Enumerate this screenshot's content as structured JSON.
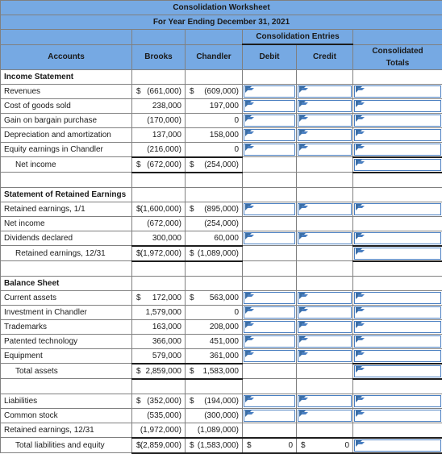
{
  "header": {
    "title": "Consolidation Worksheet",
    "subtitle": "For Year Ending December 31, 2021",
    "group_label": "Consolidation Entries",
    "columns": {
      "accounts": "Accounts",
      "brooks": "Brooks",
      "chandler": "Chandler",
      "debit": "Debit",
      "credit": "Credit",
      "consolidated": "Consolidated Totals",
      "consolidated_line1": "Consolidated",
      "consolidated_line2": "Totals"
    }
  },
  "colors": {
    "header_blue": "#76A9E3",
    "input_border": "#4a7fc1",
    "grid_line": "#808080",
    "rule_line": "#1d1d1d"
  },
  "sections": {
    "income_statement": {
      "label": "Income Statement",
      "rows": [
        {
          "label": "Revenues",
          "brooks_sym": "$",
          "brooks": "(661,000)",
          "chandler_sym": "$",
          "chandler": "(609,000)"
        },
        {
          "label": "Cost of goods sold",
          "brooks_sym": "",
          "brooks": "238,000",
          "chandler_sym": "",
          "chandler": "197,000"
        },
        {
          "label": "Gain on bargain purchase",
          "brooks_sym": "",
          "brooks": "(170,000)",
          "chandler_sym": "",
          "chandler": "0"
        },
        {
          "label": "Depreciation and amortization",
          "brooks_sym": "",
          "brooks": "137,000",
          "chandler_sym": "",
          "chandler": "158,000"
        },
        {
          "label": "Equity earnings in Chandler",
          "brooks_sym": "",
          "brooks": "(216,000)",
          "chandler_sym": "",
          "chandler": "0"
        }
      ],
      "total": {
        "label": "Net income",
        "brooks_sym": "$",
        "brooks": "(672,000)",
        "chandler_sym": "$",
        "chandler": "(254,000)"
      }
    },
    "retained_earnings": {
      "label": "Statement of Retained Earnings",
      "rows": [
        {
          "label": "Retained earnings, 1/1",
          "brooks_sym": "$",
          "brooks": "(1,600,000)",
          "chandler_sym": "$",
          "chandler": "(895,000)"
        },
        {
          "label": "Net income",
          "brooks_sym": "",
          "brooks": "(672,000)",
          "chandler_sym": "",
          "chandler": "(254,000)"
        },
        {
          "label": "Dividends declared",
          "brooks_sym": "",
          "brooks": "300,000",
          "chandler_sym": "",
          "chandler": "60,000"
        }
      ],
      "total": {
        "label": "Retained earnings, 12/31",
        "brooks_sym": "$",
        "brooks": "(1,972,000)",
        "chandler_sym": "$",
        "chandler": "(1,089,000)"
      }
    },
    "balance_sheet": {
      "label": "Balance Sheet",
      "rows": [
        {
          "label": "Current assets",
          "brooks_sym": "$",
          "brooks": "172,000",
          "chandler_sym": "$",
          "chandler": "563,000"
        },
        {
          "label": "Investment in Chandler",
          "brooks_sym": "",
          "brooks": "1,579,000",
          "chandler_sym": "",
          "chandler": "0"
        },
        {
          "label": "Trademarks",
          "brooks_sym": "",
          "brooks": "163,000",
          "chandler_sym": "",
          "chandler": "208,000"
        },
        {
          "label": "Patented technology",
          "brooks_sym": "",
          "brooks": "366,000",
          "chandler_sym": "",
          "chandler": "451,000"
        },
        {
          "label": "Equipment",
          "brooks_sym": "",
          "brooks": "579,000",
          "chandler_sym": "",
          "chandler": "361,000"
        }
      ],
      "total": {
        "label": "Total assets",
        "brooks_sym": "$",
        "brooks": "2,859,000",
        "chandler_sym": "$",
        "chandler": "1,583,000"
      }
    },
    "liabilities_equity": {
      "rows": [
        {
          "label": "Liabilities",
          "brooks_sym": "$",
          "brooks": "(352,000)",
          "chandler_sym": "$",
          "chandler": "(194,000)"
        },
        {
          "label": "Common stock",
          "brooks_sym": "",
          "brooks": "(535,000)",
          "chandler_sym": "",
          "chandler": "(300,000)"
        },
        {
          "label": "Retained earnings, 12/31",
          "brooks_sym": "",
          "brooks": "(1,972,000)",
          "chandler_sym": "",
          "chandler": "(1,089,000)"
        }
      ],
      "total": {
        "label": "Total liabilities and equity",
        "brooks_sym": "$",
        "brooks": "(2,859,000)",
        "chandler_sym": "$",
        "chandler": "(1,583,000)",
        "debit_sym": "$",
        "debit": "0",
        "credit_sym": "$",
        "credit": "0"
      }
    }
  }
}
